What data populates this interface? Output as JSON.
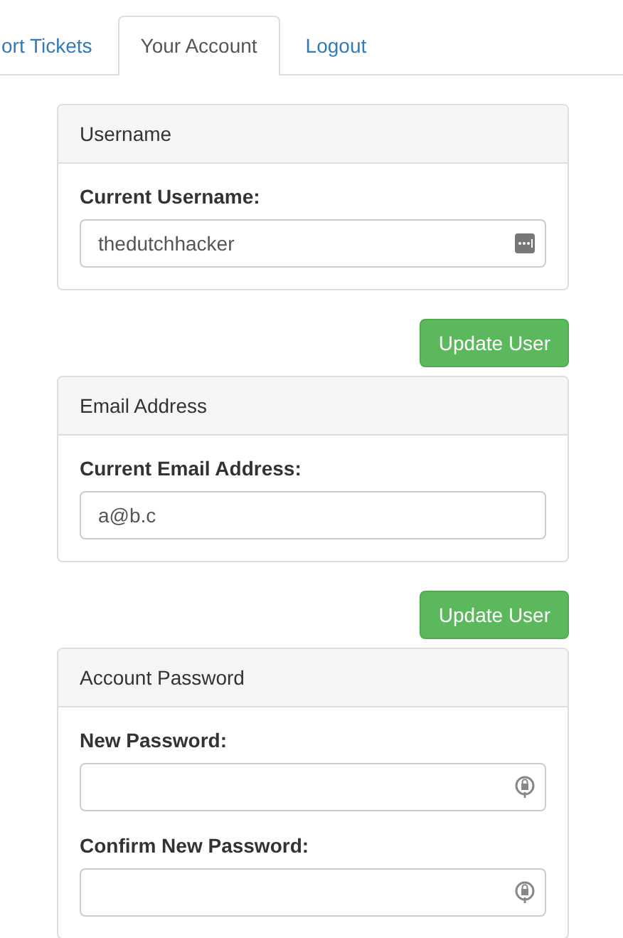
{
  "tabs": [
    {
      "label": "ort Tickets",
      "selected": false
    },
    {
      "label": "Your Account",
      "selected": true
    },
    {
      "label": "Logout",
      "selected": false
    }
  ],
  "sections": [
    {
      "title": "Username",
      "fields": [
        {
          "label": "Current Username:",
          "value": "thedutchhacker",
          "kind": "text"
        }
      ],
      "button": "Update User"
    },
    {
      "title": "Email Address",
      "fields": [
        {
          "label": "Current Email Address:",
          "value": "a@b.c",
          "kind": "email"
        }
      ],
      "button": "Update User"
    },
    {
      "title": "Account Password",
      "fields": [
        {
          "label": "New Password:",
          "kind": "password"
        },
        {
          "label": "Confirm New Password:",
          "kind": "password"
        }
      ]
    }
  ]
}
